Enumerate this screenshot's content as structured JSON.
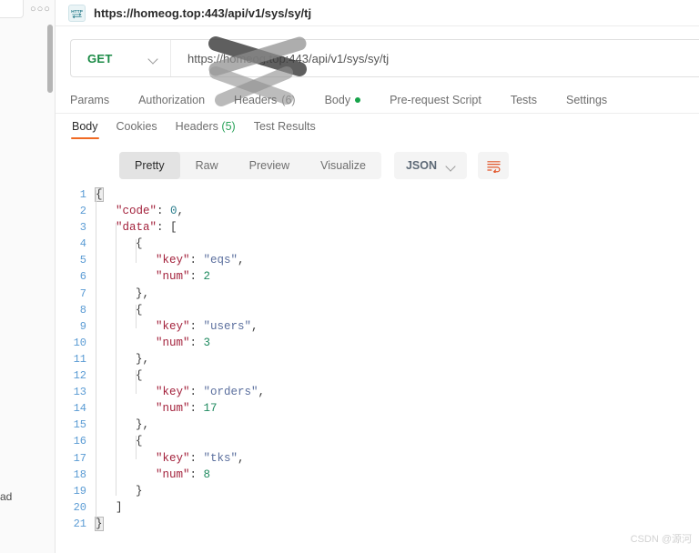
{
  "window": {
    "request_title": "https://homeog.top:443/api/v1/sys/sy/tj",
    "http_icon_label": "HTTP",
    "rail_menu_dots": "○○○",
    "rail_cut_text": "ad"
  },
  "request": {
    "method": "GET",
    "url": "https://homeog.top:443/api/v1/sys/sy/tj",
    "tabs": [
      {
        "label": "Params",
        "count": "",
        "dot": false
      },
      {
        "label": "Authorization",
        "count": "",
        "dot": false
      },
      {
        "label": "Headers",
        "count": "(6)",
        "dot": false
      },
      {
        "label": "Body",
        "count": "",
        "dot": true
      },
      {
        "label": "Pre-request Script",
        "count": "",
        "dot": false
      },
      {
        "label": "Tests",
        "count": "",
        "dot": false
      },
      {
        "label": "Settings",
        "count": "",
        "dot": false
      }
    ]
  },
  "response": {
    "tabs": [
      {
        "label": "Body",
        "count": "",
        "active": true
      },
      {
        "label": "Cookies",
        "count": "",
        "active": false
      },
      {
        "label": "Headers",
        "count": "(5)",
        "active": false
      },
      {
        "label": "Test Results",
        "count": "",
        "active": false
      }
    ],
    "view_modes": [
      {
        "label": "Pretty",
        "active": true
      },
      {
        "label": "Raw",
        "active": false
      },
      {
        "label": "Preview",
        "active": false
      },
      {
        "label": "Visualize",
        "active": false
      }
    ],
    "format": "JSON",
    "wrap_icon": "word-wrap-icon",
    "body_lines": [
      {
        "n": 1,
        "indent": 0,
        "parts": [
          {
            "t": "{",
            "c": "brace"
          }
        ],
        "hl": true
      },
      {
        "n": 2,
        "indent": 1,
        "parts": [
          {
            "t": "\"code\"",
            "c": "key"
          },
          {
            "t": ": ",
            "c": "punct"
          },
          {
            "t": "0",
            "c": "num0"
          },
          {
            "t": ",",
            "c": "punct"
          }
        ]
      },
      {
        "n": 3,
        "indent": 1,
        "parts": [
          {
            "t": "\"data\"",
            "c": "key"
          },
          {
            "t": ": ",
            "c": "punct"
          },
          {
            "t": "[",
            "c": "brace"
          }
        ]
      },
      {
        "n": 4,
        "indent": 2,
        "parts": [
          {
            "t": "{",
            "c": "brace"
          }
        ]
      },
      {
        "n": 5,
        "indent": 3,
        "parts": [
          {
            "t": "\"key\"",
            "c": "key"
          },
          {
            "t": ": ",
            "c": "punct"
          },
          {
            "t": "\"eqs\"",
            "c": "str"
          },
          {
            "t": ",",
            "c": "punct"
          }
        ]
      },
      {
        "n": 6,
        "indent": 3,
        "parts": [
          {
            "t": "\"num\"",
            "c": "key"
          },
          {
            "t": ": ",
            "c": "punct"
          },
          {
            "t": "2",
            "c": "num"
          }
        ]
      },
      {
        "n": 7,
        "indent": 2,
        "parts": [
          {
            "t": "}",
            "c": "brace"
          },
          {
            "t": ",",
            "c": "punct"
          }
        ]
      },
      {
        "n": 8,
        "indent": 2,
        "parts": [
          {
            "t": "{",
            "c": "brace"
          }
        ]
      },
      {
        "n": 9,
        "indent": 3,
        "parts": [
          {
            "t": "\"key\"",
            "c": "key"
          },
          {
            "t": ": ",
            "c": "punct"
          },
          {
            "t": "\"users\"",
            "c": "str"
          },
          {
            "t": ",",
            "c": "punct"
          }
        ]
      },
      {
        "n": 10,
        "indent": 3,
        "parts": [
          {
            "t": "\"num\"",
            "c": "key"
          },
          {
            "t": ": ",
            "c": "punct"
          },
          {
            "t": "3",
            "c": "num"
          }
        ]
      },
      {
        "n": 11,
        "indent": 2,
        "parts": [
          {
            "t": "}",
            "c": "brace"
          },
          {
            "t": ",",
            "c": "punct"
          }
        ]
      },
      {
        "n": 12,
        "indent": 2,
        "parts": [
          {
            "t": "{",
            "c": "brace"
          }
        ]
      },
      {
        "n": 13,
        "indent": 3,
        "parts": [
          {
            "t": "\"key\"",
            "c": "key"
          },
          {
            "t": ": ",
            "c": "punct"
          },
          {
            "t": "\"orders\"",
            "c": "str"
          },
          {
            "t": ",",
            "c": "punct"
          }
        ]
      },
      {
        "n": 14,
        "indent": 3,
        "parts": [
          {
            "t": "\"num\"",
            "c": "key"
          },
          {
            "t": ": ",
            "c": "punct"
          },
          {
            "t": "17",
            "c": "num"
          }
        ]
      },
      {
        "n": 15,
        "indent": 2,
        "parts": [
          {
            "t": "}",
            "c": "brace"
          },
          {
            "t": ",",
            "c": "punct"
          }
        ]
      },
      {
        "n": 16,
        "indent": 2,
        "parts": [
          {
            "t": "{",
            "c": "brace"
          }
        ]
      },
      {
        "n": 17,
        "indent": 3,
        "parts": [
          {
            "t": "\"key\"",
            "c": "key"
          },
          {
            "t": ": ",
            "c": "punct"
          },
          {
            "t": "\"tks\"",
            "c": "str"
          },
          {
            "t": ",",
            "c": "punct"
          }
        ]
      },
      {
        "n": 18,
        "indent": 3,
        "parts": [
          {
            "t": "\"num\"",
            "c": "key"
          },
          {
            "t": ": ",
            "c": "punct"
          },
          {
            "t": "8",
            "c": "num"
          }
        ]
      },
      {
        "n": 19,
        "indent": 2,
        "parts": [
          {
            "t": "}",
            "c": "brace"
          }
        ]
      },
      {
        "n": 20,
        "indent": 1,
        "parts": [
          {
            "t": "]",
            "c": "brace"
          }
        ]
      },
      {
        "n": 21,
        "indent": 0,
        "parts": [
          {
            "t": "}",
            "c": "brace"
          }
        ],
        "hl": true
      }
    ],
    "parsed_body": {
      "code": 0,
      "data": [
        {
          "key": "eqs",
          "num": 2
        },
        {
          "key": "users",
          "num": 3
        },
        {
          "key": "orders",
          "num": 17
        },
        {
          "key": "tks",
          "num": 8
        }
      ]
    }
  },
  "watermark": "CSDN @源河",
  "colors": {
    "accent_orange": "#f06a23",
    "method_green": "#1a8a45",
    "count_green": "#2aa35a",
    "json_key": "#a3223c",
    "json_string": "#5b6f9e",
    "json_number": "#1f8a5f",
    "gutter": "#5a9bd4"
  }
}
